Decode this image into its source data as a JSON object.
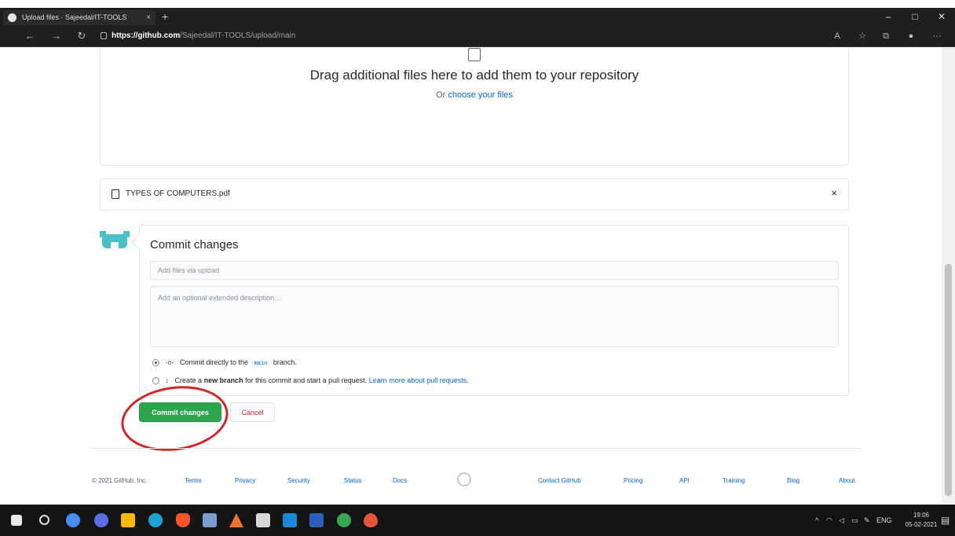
{
  "browser": {
    "tab_title": "Upload files · Sajeedal/IT-TOOLS",
    "tab_close": "×",
    "new_tab": "+",
    "url_host": "https://github.com",
    "url_path": "/Sajeedal/IT-TOOLS/upload/main",
    "window_controls": [
      "–",
      "□",
      "✕"
    ]
  },
  "dropzone": {
    "title": "Drag additional files here to add them to your repository",
    "sub_prefix": "Or ",
    "choose_link": "choose your files"
  },
  "file": {
    "name": "TYPES OF COMPUTERS.pdf",
    "remove": "×"
  },
  "commit": {
    "title": "Commit changes",
    "summary_placeholder": "Add files via upload",
    "description_placeholder": "Add an optional extended description…",
    "direct_prefix": "Commit directly to the",
    "branch": "main",
    "direct_suffix": "branch.",
    "newbranch_prefix": "Create a",
    "newbranch_bold": "new branch",
    "newbranch_suffix": "for this commit and start a pull request.",
    "learn_more": "Learn more about pull requests.",
    "commit_button": "Commit changes",
    "cancel_button": "Cancel"
  },
  "footer": {
    "copyright": "© 2021 GitHub, Inc.",
    "links": [
      "Terms",
      "Privacy",
      "Security",
      "Status",
      "Docs",
      "Contact GitHub",
      "Pricing",
      "API",
      "Training",
      "Blog",
      "About"
    ]
  },
  "taskbar": {
    "language": "ENG",
    "time": "19:06",
    "date": "05-02-2021"
  },
  "colors": {
    "commit_green": "#2ea44f",
    "cancel_red": "#cb2431",
    "link_blue": "#0366d6",
    "annotation_red": "#d32424",
    "avatar_teal": "#4ac1c9"
  }
}
